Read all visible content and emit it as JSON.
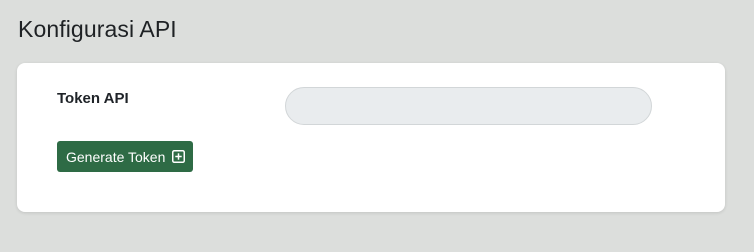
{
  "page": {
    "title": "Konfigurasi API"
  },
  "form": {
    "token_label": "Token API",
    "token_value": "",
    "generate_label": "Generate Token",
    "generate_icon": "plus-square-icon"
  },
  "colors": {
    "background": "#dcdedc",
    "card": "#ffffff",
    "button": "#2e6b45",
    "input_bg": "#e9ecee"
  }
}
